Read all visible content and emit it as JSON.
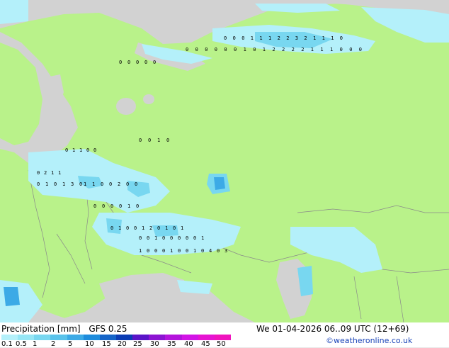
{
  "title": "Precipitation [mm]",
  "model": "GFS 0.25",
  "run_time": "We 01-04-2026 06..09 UTC (12+69)",
  "credit": "©weatheronline.co.uk",
  "legend": {
    "ticks": [
      "0.1",
      "0.5",
      "1",
      "2",
      "5",
      "10",
      "15",
      "20",
      "25",
      "30",
      "35",
      "40",
      "45",
      "50"
    ],
    "colors": [
      "#b4f0fa",
      "#96e6f5",
      "#78d7f0",
      "#5ac3eb",
      "#3caae6",
      "#1e8cdc",
      "#1464c8",
      "#0a3cb4",
      "#5a14c8",
      "#8c14d2",
      "#b414dc",
      "#d214e6",
      "#e614d2",
      "#f014be"
    ]
  },
  "colors": {
    "land": "#b9f28a",
    "sea": "#d2d2d2",
    "precip_light": "#b4f0fa",
    "precip_medium": "#78d7f0",
    "precip_heavy": "#3caae6"
  },
  "grid_values": {
    "rows": [
      [
        "0",
        "0",
        "0",
        "1",
        "1",
        "1",
        "2",
        "2",
        "3",
        "2",
        "1",
        "1",
        "1",
        "0"
      ],
      [
        "0",
        "0",
        "0",
        "0",
        "0",
        "0",
        "1",
        "0",
        "1",
        "2",
        "2",
        "2",
        "2",
        "1",
        "1",
        "1",
        "0",
        "0",
        "0"
      ],
      [
        "0",
        "0",
        "0",
        "0",
        "0"
      ],
      [
        "0",
        "0",
        "1",
        "0"
      ],
      [
        "0",
        "1",
        "1",
        "0",
        "0"
      ],
      [
        "0",
        "2",
        "1",
        "1"
      ],
      [
        "0",
        "1",
        "0",
        "1",
        "3",
        "0"
      ],
      [
        "1",
        "1",
        "0",
        "0",
        "2",
        "0",
        "0"
      ],
      [
        "0",
        "0",
        "0",
        "0",
        "1",
        "0"
      ],
      [
        "0",
        "1",
        "0",
        "0",
        "1",
        "2",
        "0",
        "1",
        "0",
        "1"
      ],
      [
        "0",
        "0",
        "1",
        "0",
        "0",
        "0",
        "0",
        "0",
        "1"
      ],
      [
        "1",
        "0",
        "0",
        "0",
        "1",
        "0",
        "0",
        "1",
        "0",
        "4",
        "0",
        "3"
      ]
    ]
  }
}
